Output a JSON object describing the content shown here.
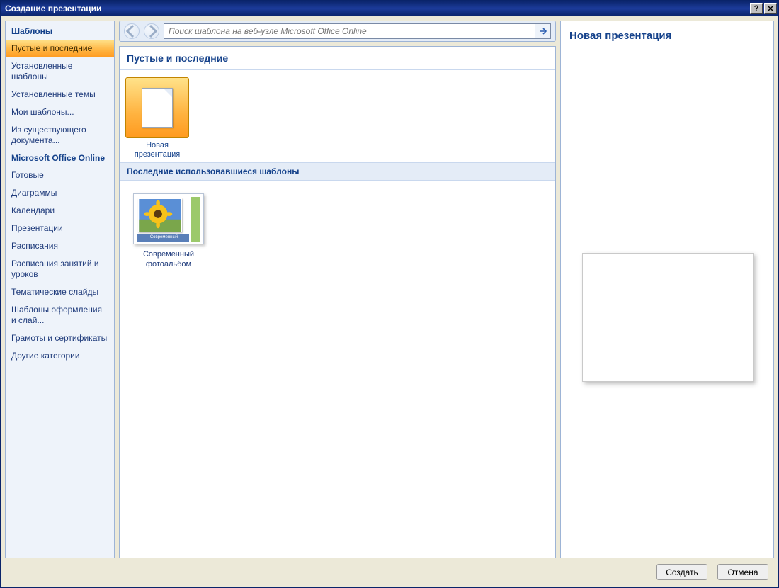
{
  "window": {
    "title": "Создание презентации"
  },
  "sidebar": {
    "header1": "Шаблоны",
    "items1": [
      {
        "label": "Пустые и последние",
        "active": true
      },
      {
        "label": "Установленные шаблоны"
      },
      {
        "label": "Установленные темы"
      },
      {
        "label": "Мои шаблоны..."
      },
      {
        "label": "Из существующего документа..."
      }
    ],
    "header2": "Microsoft Office Online",
    "items2": [
      {
        "label": "Готовые"
      },
      {
        "label": "Диаграммы"
      },
      {
        "label": "Календари"
      },
      {
        "label": "Презентации"
      },
      {
        "label": "Расписания"
      },
      {
        "label": "Расписания занятий и уроков"
      },
      {
        "label": "Тематические слайды"
      },
      {
        "label": "Шаблоны оформления и слай..."
      },
      {
        "label": "Грамоты и сертификаты"
      },
      {
        "label": "Другие категории"
      }
    ]
  },
  "search": {
    "placeholder": "Поиск шаблона на веб-узле Microsoft Office Online"
  },
  "main": {
    "section_title": "Пустые и последние",
    "new_tile_label": "Новая презентация",
    "recent_header": "Последние использовавшиеся шаблоны",
    "recent_items": [
      {
        "label": "Современный фотоальбом",
        "thumb_caption": "Современный фотоальбом"
      }
    ]
  },
  "preview": {
    "title": "Новая презентация"
  },
  "footer": {
    "create": "Создать",
    "cancel": "Отмена"
  }
}
